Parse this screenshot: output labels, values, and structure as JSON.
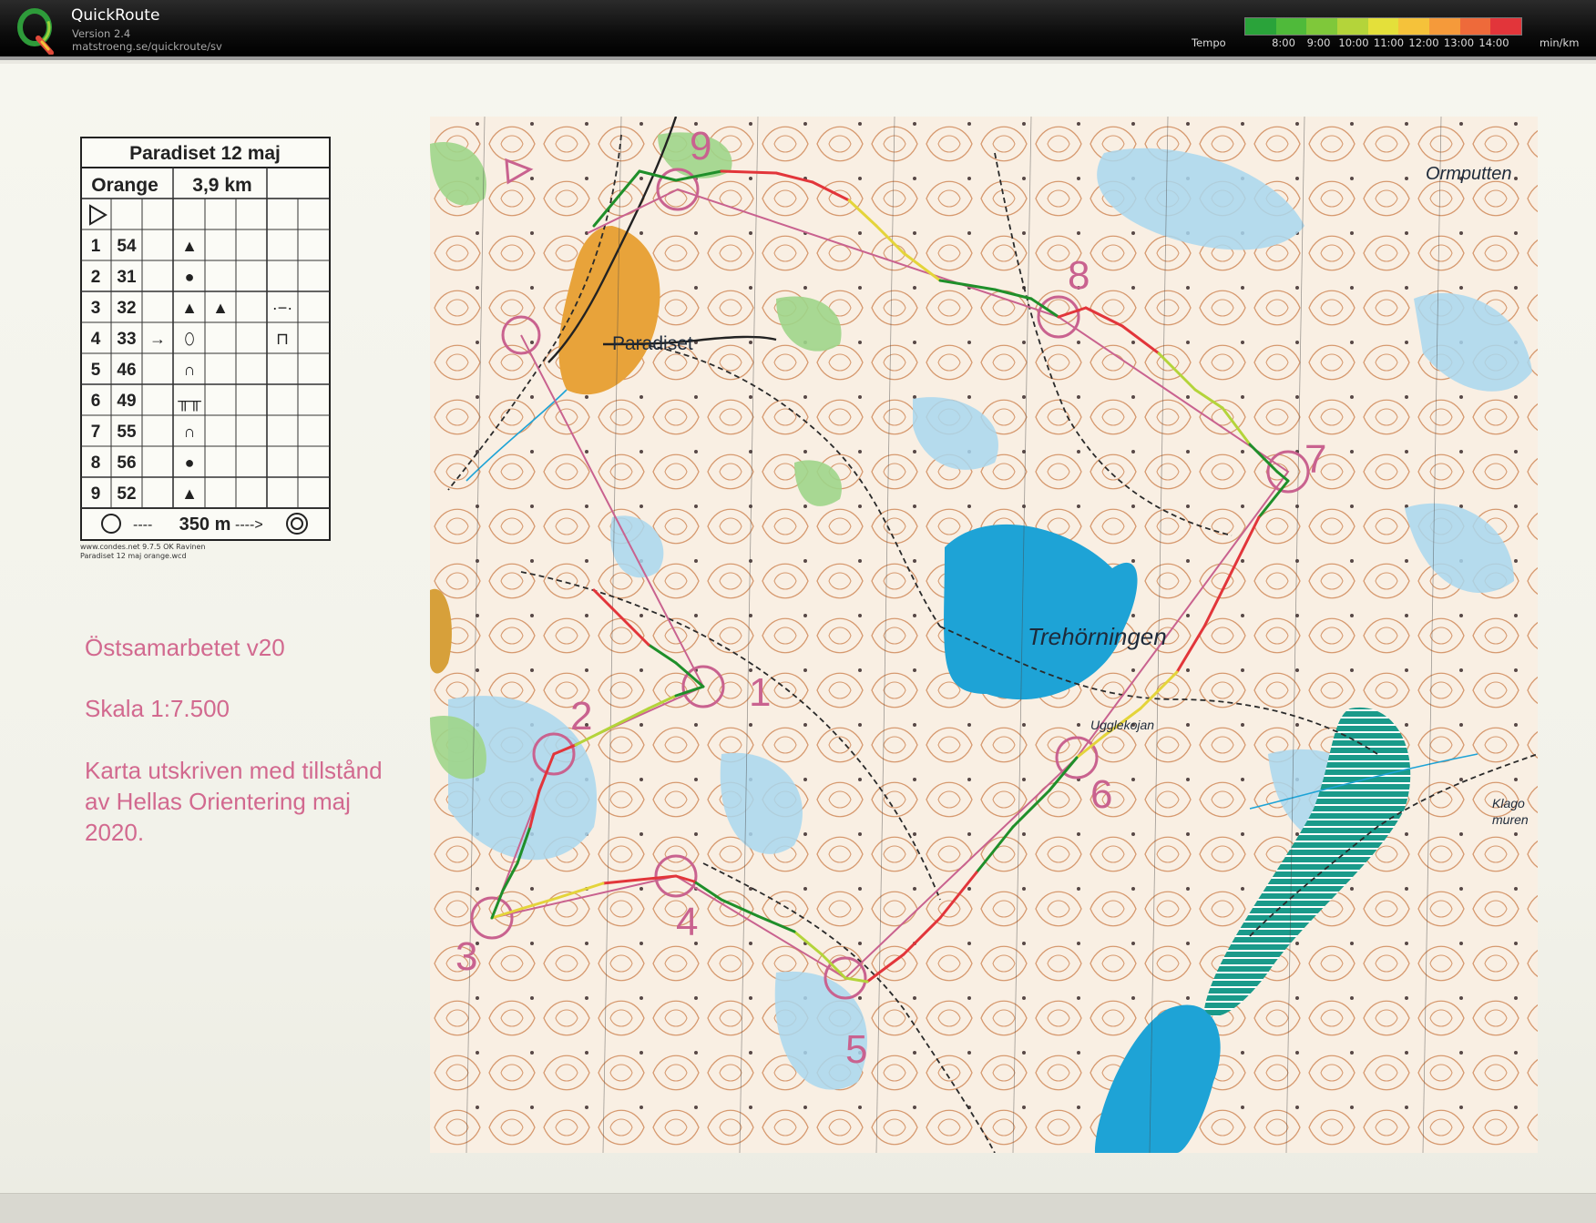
{
  "app": {
    "title": "QuickRoute",
    "version": "Version 2.4",
    "url": "matstroeng.se/quickroute/sv"
  },
  "legend": {
    "label": "Tempo",
    "unit": "min/km",
    "ticks": [
      "8:00",
      "9:00",
      "10:00",
      "11:00",
      "12:00",
      "13:00",
      "14:00"
    ],
    "colors": [
      "#2aa33a",
      "#4fba3a",
      "#7fc83a",
      "#b4d43a",
      "#e4e03a",
      "#f5c23a",
      "#f59a3a",
      "#ee6a3a",
      "#e2353a"
    ]
  },
  "control_card": {
    "title": "Paradiset 12 maj",
    "class": "Orange",
    "length": "3,9 km",
    "rows": [
      {
        "num": "1",
        "code": "54",
        "d1": "▲",
        "d2": "",
        "extra": ""
      },
      {
        "num": "2",
        "code": "31",
        "d1": "●",
        "d2": "",
        "extra": ""
      },
      {
        "num": "3",
        "code": "32",
        "d1": "▲",
        "d2": "▲",
        "extra": "·−·"
      },
      {
        "num": "4",
        "code": "33",
        "d1": "⬯",
        "d2": "",
        "extra": "⊓"
      },
      {
        "num": "5",
        "code": "46",
        "d1": "∩",
        "d2": "",
        "extra": ""
      },
      {
        "num": "6",
        "code": "49",
        "d1": "╥╥",
        "d2": "",
        "extra": ""
      },
      {
        "num": "7",
        "code": "55",
        "d1": "∩",
        "d2": "",
        "extra": ""
      },
      {
        "num": "8",
        "code": "56",
        "d1": "●",
        "d2": "",
        "extra": ""
      },
      {
        "num": "9",
        "code": "52",
        "d1": "▲",
        "d2": "",
        "extra": ""
      }
    ],
    "finish": "350 m",
    "footer_line1": "www.condes.net 9.7.5 OK Ravinen",
    "footer_line2": "Paradiset 12 maj orange.wcd"
  },
  "info": {
    "line1": "Östsamarbetet v20",
    "line2": "Skala 1:7.500",
    "line3": "Karta utskriven med tillstånd",
    "line4": "av Hellas Orientering maj",
    "line5": "2020."
  },
  "map": {
    "labels": {
      "paradiset": "Paradiset",
      "ormputten": "Ormputten",
      "trehorningen": "Trehörningen",
      "ugglekojan": "Ugglekojan",
      "klago1": "Klago",
      "klago2": "muren"
    },
    "control_numbers": [
      "1",
      "2",
      "3",
      "4",
      "5",
      "6",
      "7",
      "8",
      "9"
    ],
    "colors": {
      "course": "#c9628f",
      "contour": "#c97a4a",
      "water": "#1ea3d6",
      "open_land": "#e8a33a",
      "vegetation": "#9fd58a"
    }
  }
}
